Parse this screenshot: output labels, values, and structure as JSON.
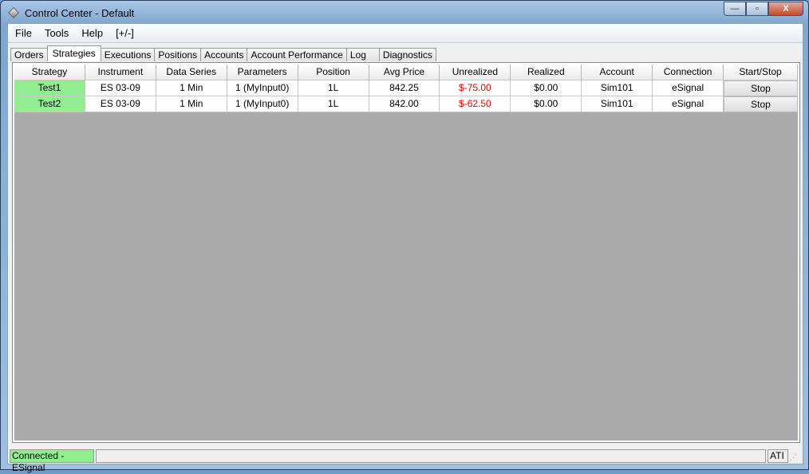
{
  "window": {
    "title": "Control Center - Default",
    "minimize": "—",
    "maximize": "▫",
    "close": "X"
  },
  "menu": [
    "File",
    "Tools",
    "Help",
    "[+/-]"
  ],
  "tabs": [
    "Orders",
    "Strategies",
    "Executions",
    "Positions",
    "Accounts",
    "Account Performance",
    "Log",
    "Diagnostics"
  ],
  "active_tab": "Strategies",
  "table": {
    "columns": [
      "Strategy",
      "Instrument",
      "Data Series",
      "Parameters",
      "Position",
      "Avg Price",
      "Unrealized",
      "Realized",
      "Account",
      "Connection",
      "Start/Stop"
    ],
    "rows": [
      [
        "Test1",
        "ES 03-09",
        "1 Min",
        "1 (MyInput0)",
        "1L",
        "842.25",
        "$-75.00",
        "$0.00",
        "Sim101",
        "eSignal",
        "Stop"
      ],
      [
        "Test2",
        "ES 03-09",
        "1 Min",
        "1 (MyInput0)",
        "1L",
        "842.00",
        "$-62.50",
        "$0.00",
        "Sim101",
        "eSignal",
        "Stop"
      ]
    ]
  },
  "status": {
    "connection": "Connected - ESignal",
    "message": "",
    "right": "ATI"
  },
  "colors": {
    "running": "#90ee90",
    "negative": "#e00000",
    "grid_bg": "#ababab"
  }
}
